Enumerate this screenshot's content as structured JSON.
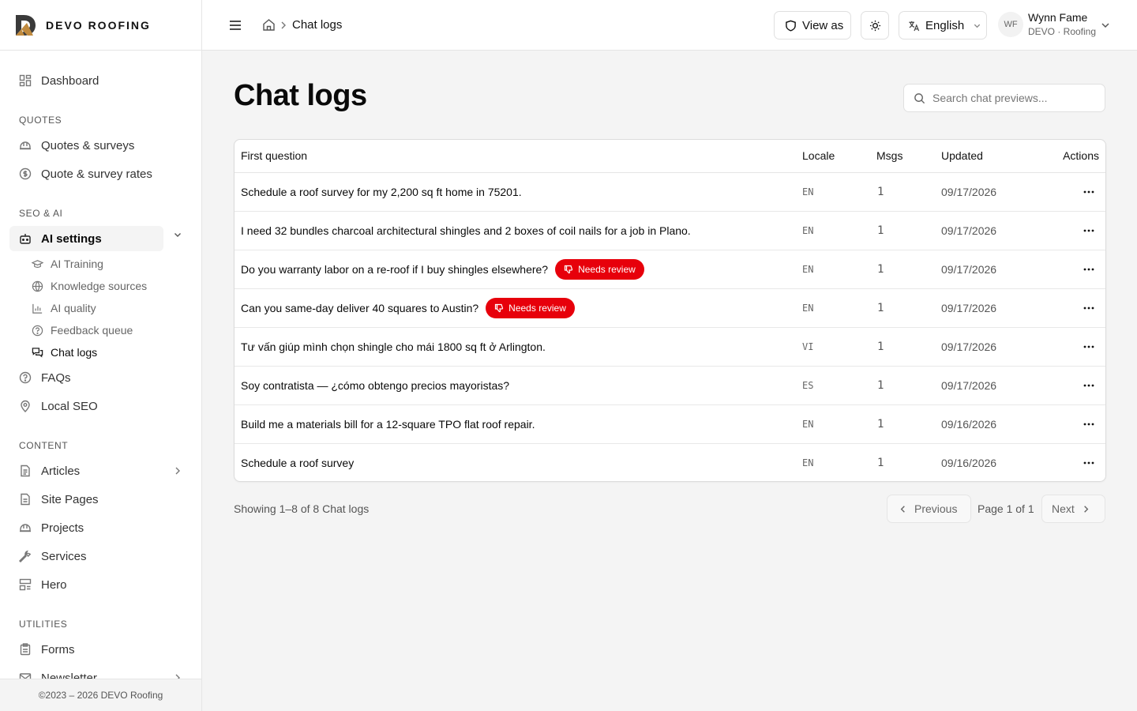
{
  "brand": {
    "name": "DEVO ROOFING"
  },
  "sidebar": {
    "dashboard": "Dashboard",
    "sections": {
      "quotes": "QUOTES",
      "seo_ai": "SEO & AI",
      "content": "CONTENT",
      "utilities": "UTILITIES"
    },
    "quotes_items": [
      "Quotes & surveys",
      "Quote & survey rates"
    ],
    "ai_settings": "AI settings",
    "ai_sub_items": [
      "AI Training",
      "Knowledge sources",
      "AI quality",
      "Feedback queue",
      "Chat logs"
    ],
    "seo_items": [
      "FAQs",
      "Local SEO"
    ],
    "content_items": [
      "Articles",
      "Site Pages",
      "Projects",
      "Services",
      "Hero"
    ],
    "utilities_items": [
      "Forms",
      "Newsletter"
    ],
    "footer": "©2023 – 2026 DEVO Roofing"
  },
  "topbar": {
    "breadcrumb_current": "Chat logs",
    "view_as": "View as",
    "language": "English",
    "user": {
      "initials": "WF",
      "name": "Wynn Fame",
      "org": "DEVO · Roofing"
    }
  },
  "main": {
    "title": "Chat logs",
    "search_placeholder": "Search chat previews...",
    "columns": [
      "First question",
      "Locale",
      "Msgs",
      "Updated",
      "Actions"
    ],
    "rows": [
      {
        "question": "Schedule a roof survey for my 2,200 sq ft home in 75201.",
        "badge": "",
        "locale": "EN",
        "msgs": "1",
        "updated": "09/17/2026"
      },
      {
        "question": "I need 32 bundles charcoal architectural shingles and 2 boxes of coil nails for a job in Plano.",
        "badge": "",
        "locale": "EN",
        "msgs": "1",
        "updated": "09/17/2026"
      },
      {
        "question": "Do you warranty labor on a re-roof if I buy shingles elsewhere?",
        "badge": "Needs review",
        "locale": "EN",
        "msgs": "1",
        "updated": "09/17/2026"
      },
      {
        "question": "Can you same-day deliver 40 squares to Austin?",
        "badge": "Needs review",
        "locale": "EN",
        "msgs": "1",
        "updated": "09/17/2026"
      },
      {
        "question": "Tư vấn giúp mình chọn shingle cho mái 1800 sq ft ở Arlington.",
        "badge": "",
        "locale": "VI",
        "msgs": "1",
        "updated": "09/17/2026"
      },
      {
        "question": "Soy contratista — ¿cómo obtengo precios mayoristas?",
        "badge": "",
        "locale": "ES",
        "msgs": "1",
        "updated": "09/17/2026"
      },
      {
        "question": "Build me a materials bill for a 12-square TPO flat roof repair.",
        "badge": "",
        "locale": "EN",
        "msgs": "1",
        "updated": "09/16/2026"
      },
      {
        "question": "Schedule a roof survey",
        "badge": "",
        "locale": "EN",
        "msgs": "1",
        "updated": "09/16/2026"
      }
    ],
    "showing": "Showing 1–8 of 8 Chat logs",
    "pagination": {
      "previous": "Previous",
      "page": "Page 1 of 1",
      "next": "Next"
    }
  },
  "colors": {
    "badge": "#e7000b",
    "accent": "#0a0a0a"
  }
}
